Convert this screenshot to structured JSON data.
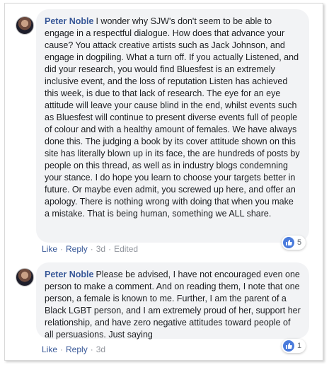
{
  "comments": [
    {
      "author": "Peter Noble",
      "text": "I wonder why SJW's don't seem to be able to engage in a respectful dialogue. How does that advance your cause? You attack creative artists such as Jack Johnson, and engage in dogpiling. What a turn off. If you actually Listened, and did your research, you would find Bluesfest is an extremely inclusive event, and the loss of reputation Listen has achieved this week, is due to that lack of research. The eye for an eye attitude will leave your cause blind in the end, whilst events such as Bluesfest will continue to present diverse events full of people of colour and with a healthy amount of females. We have always done this. The judging a book by its cover attitude shown on this site has literally blown up in its face, the are hundreds of posts by people on this thread, as well as in industry blogs condemning your stance. I do hope you learn to choose your targets better in future. Or maybe even admit, you screwed up here, and offer an apology. There is nothing wrong with doing that when you make a mistake. That is being human, something we ALL share.",
      "like_label": "Like",
      "reply_label": "Reply",
      "time": "3d",
      "edited_label": "Edited",
      "reaction_count": "5"
    },
    {
      "author": "Peter Noble",
      "text": "Please be advised, I have not encouraged even one person to make a comment. And on reading them, I note that one person, a female is known to me. Further, I am the parent of a Black LGBT person, and I am extremely proud of her, support her relationship, and have zero negative attitudes toward people of all persuasions. Just saying",
      "like_label": "Like",
      "reply_label": "Reply",
      "time": "3d",
      "reaction_count": "1"
    }
  ],
  "icons": {
    "avatar": "user-avatar",
    "reaction": "thumbs-up-icon"
  },
  "colors": {
    "link": "#385898",
    "bubble": "#f2f3f5",
    "like": "#4a7bdc",
    "muted": "#90949c"
  }
}
